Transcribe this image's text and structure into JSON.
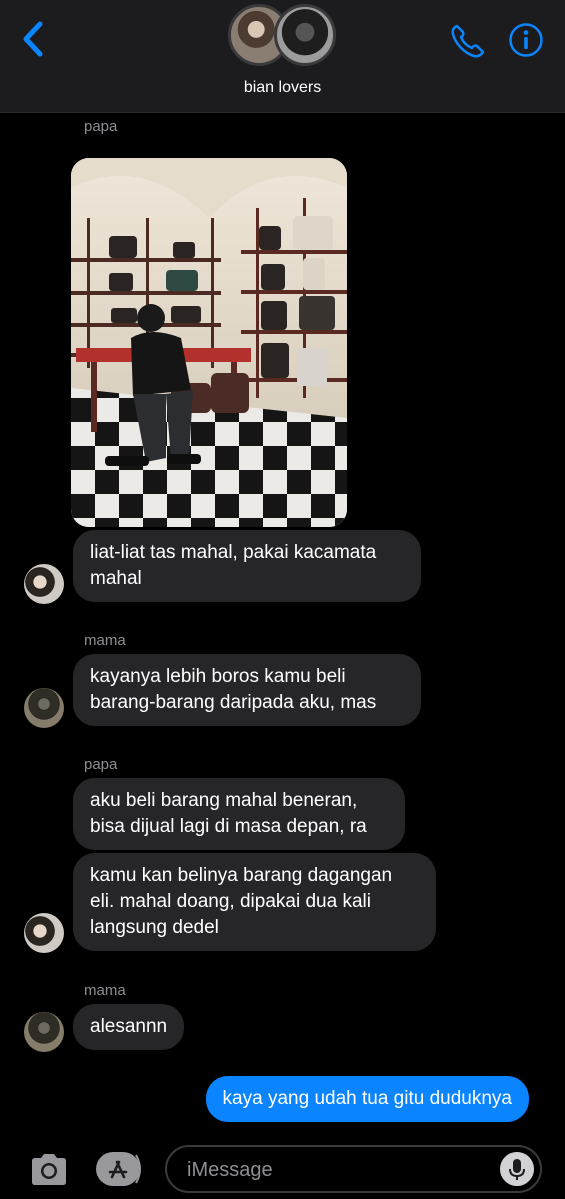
{
  "header": {
    "group_name": "bian lovers",
    "icons": [
      "chevron-left-icon",
      "phone-icon",
      "info-icon"
    ],
    "accent": "#0a84ff"
  },
  "thread": {
    "messages": [
      {
        "sender": "papa",
        "type": "image",
        "description_icon": "photo"
      },
      {
        "sender": "papa",
        "text": "liat-liat tas mahal, pakai kacamata mahal"
      },
      {
        "sender": "mama",
        "text": "kayanya lebih boros kamu beli barang-barang daripada aku, mas"
      },
      {
        "sender": "papa",
        "text": "aku beli barang mahal beneran, bisa dijual lagi di masa depan, ra"
      },
      {
        "sender": "papa",
        "text": "kamu kan belinya barang dagangan eli. mahal doang, dipakai dua kali langsung dedel"
      },
      {
        "sender": "mama",
        "text": "alesannn"
      },
      {
        "sender": "me",
        "text": "kaya yang udah tua gitu duduknya"
      }
    ],
    "labels": {
      "papa_1": "papa",
      "mama_1": "mama",
      "papa_2": "papa",
      "mama_2": "mama"
    },
    "bubble_color_other": "#262628",
    "bubble_color_me": "#0a84ff"
  },
  "input_bar": {
    "placeholder": "iMessage",
    "icons": [
      "camera-icon",
      "app-store-icon",
      "microphone-icon"
    ]
  }
}
